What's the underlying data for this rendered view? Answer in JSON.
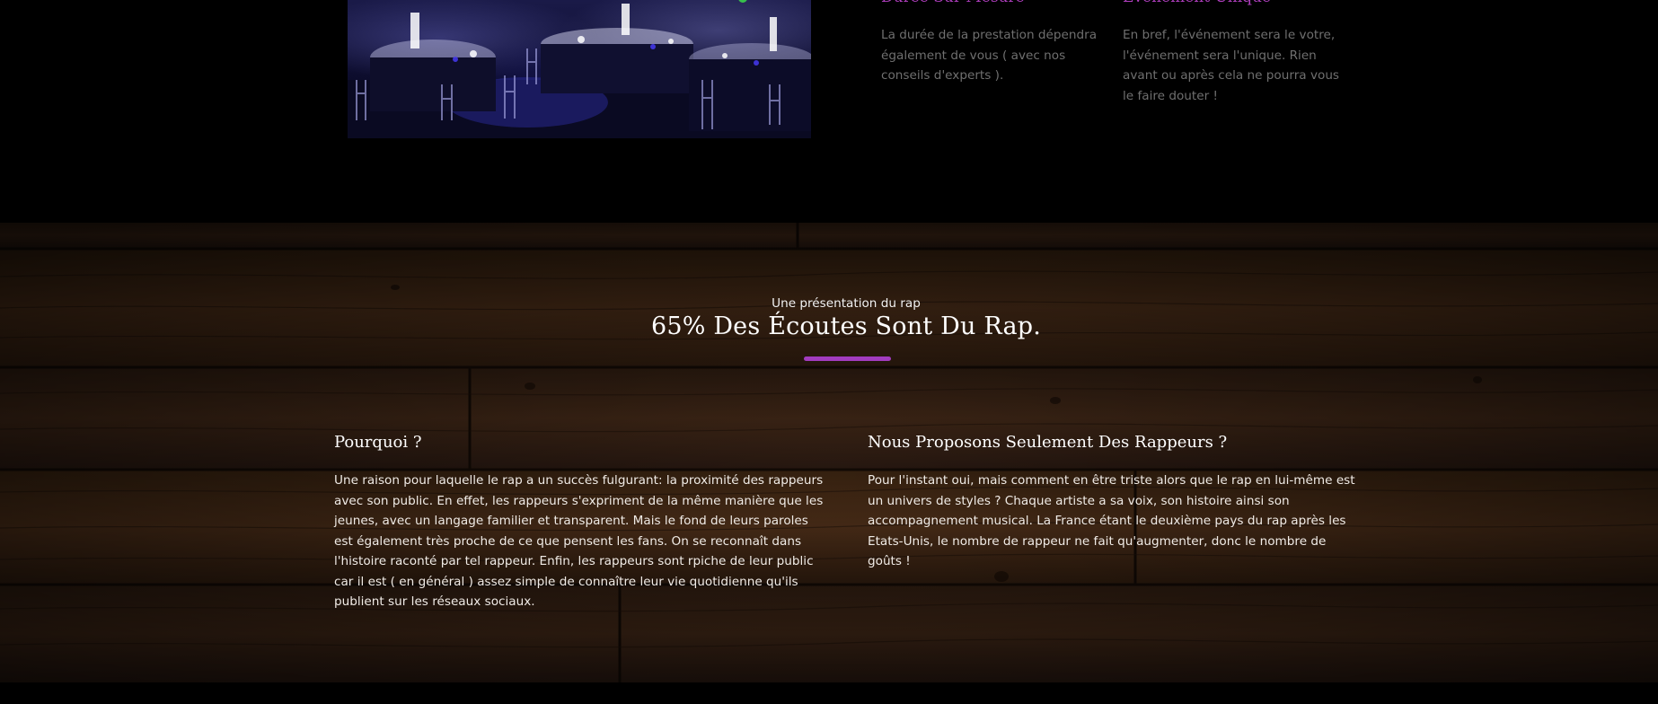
{
  "top": {
    "features": [
      {
        "title": "Durée Sur Mesure",
        "text": "La durée de la prestation dépendra également de vous ( avec nos conseils d'experts )."
      },
      {
        "title": "Événement Unique",
        "text": "En bref, l'événement sera le votre, l'événement sera l'unique. Rien avant ou après cela ne pourra vous le faire douter !"
      }
    ]
  },
  "presentation": {
    "kicker": "Une présentation du rap",
    "title": "65% Des Écoutes Sont Du Rap.",
    "accent_color": "#a23cbf",
    "columns": [
      {
        "title": "Pourquoi ?",
        "text": "Une raison pour laquelle le rap a un succès fulgurant: la proximité des rappeurs avec son public. En effet, les rappeurs s'expriment de la même manière que les jeunes, avec un langage familier et transparent. Mais le fond de leurs paroles est également très proche de ce que pensent les fans. On se reconnaît dans l'histoire raconté par tel rappeur. Enfin, les rappeurs sont rpiche de leur public car il est ( en général ) assez simple de connaître leur vie quotidienne qu'ils publient sur les réseaux sociaux."
      },
      {
        "title": "Nous Proposons Seulement Des Rappeurs ?",
        "text": "Pour l'instant oui, mais comment en être triste alors que le rap en lui-même est un univers de styles ? Chaque artiste a sa voix, son histoire ainsi son accompagnement musical. La France étant le deuxième pays du rap après les Etats-Unis, le nombre de rappeur ne fait qu'augmenter, donc le nombre de goûts !"
      }
    ]
  },
  "colors": {
    "feature_title": "#b13fc0",
    "feature_text": "#6f6f6f",
    "wood": "#3a2416"
  }
}
